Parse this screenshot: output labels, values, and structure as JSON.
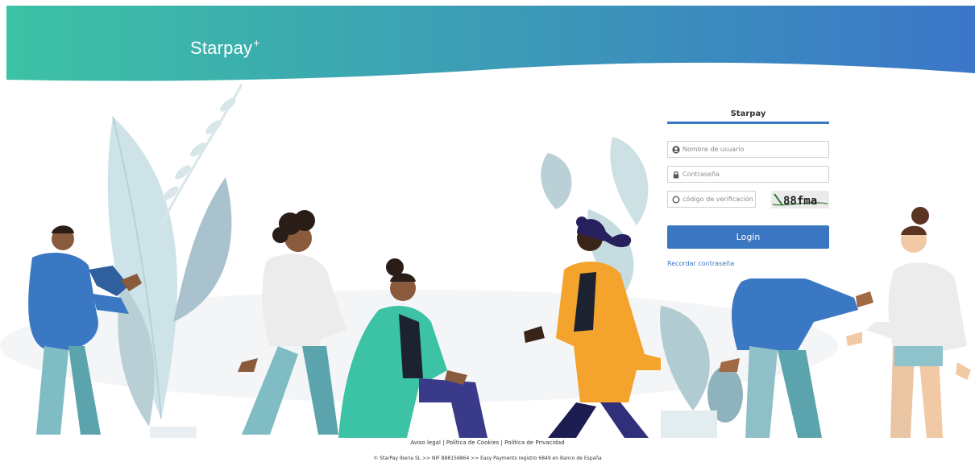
{
  "brand": {
    "logo_text": "Starpay",
    "logo_sup": "+",
    "gradient_start": "#3cc2a4",
    "gradient_end": "#3b76c8"
  },
  "login": {
    "title": "Starpay",
    "username_placeholder": "Nombre de usuario",
    "password_placeholder": "Contraseña",
    "verification_placeholder": "código de verificación",
    "captcha_text": "88fma",
    "login_label": "Login",
    "remember_label": "Recordar contraseña",
    "accent_color": "#3b76c2"
  },
  "footer": {
    "links": [
      "Aviso legal",
      "Política de Cookies",
      "Política de Privacidad"
    ],
    "separator": "|",
    "copyright": "© StarPay Iberia SL >> NIF B88156864 >> Easy Payments registro 6849 en Banco de España"
  },
  "icons": {
    "username": "user-circle-icon",
    "password": "lock-icon",
    "verification": "circle-icon"
  }
}
